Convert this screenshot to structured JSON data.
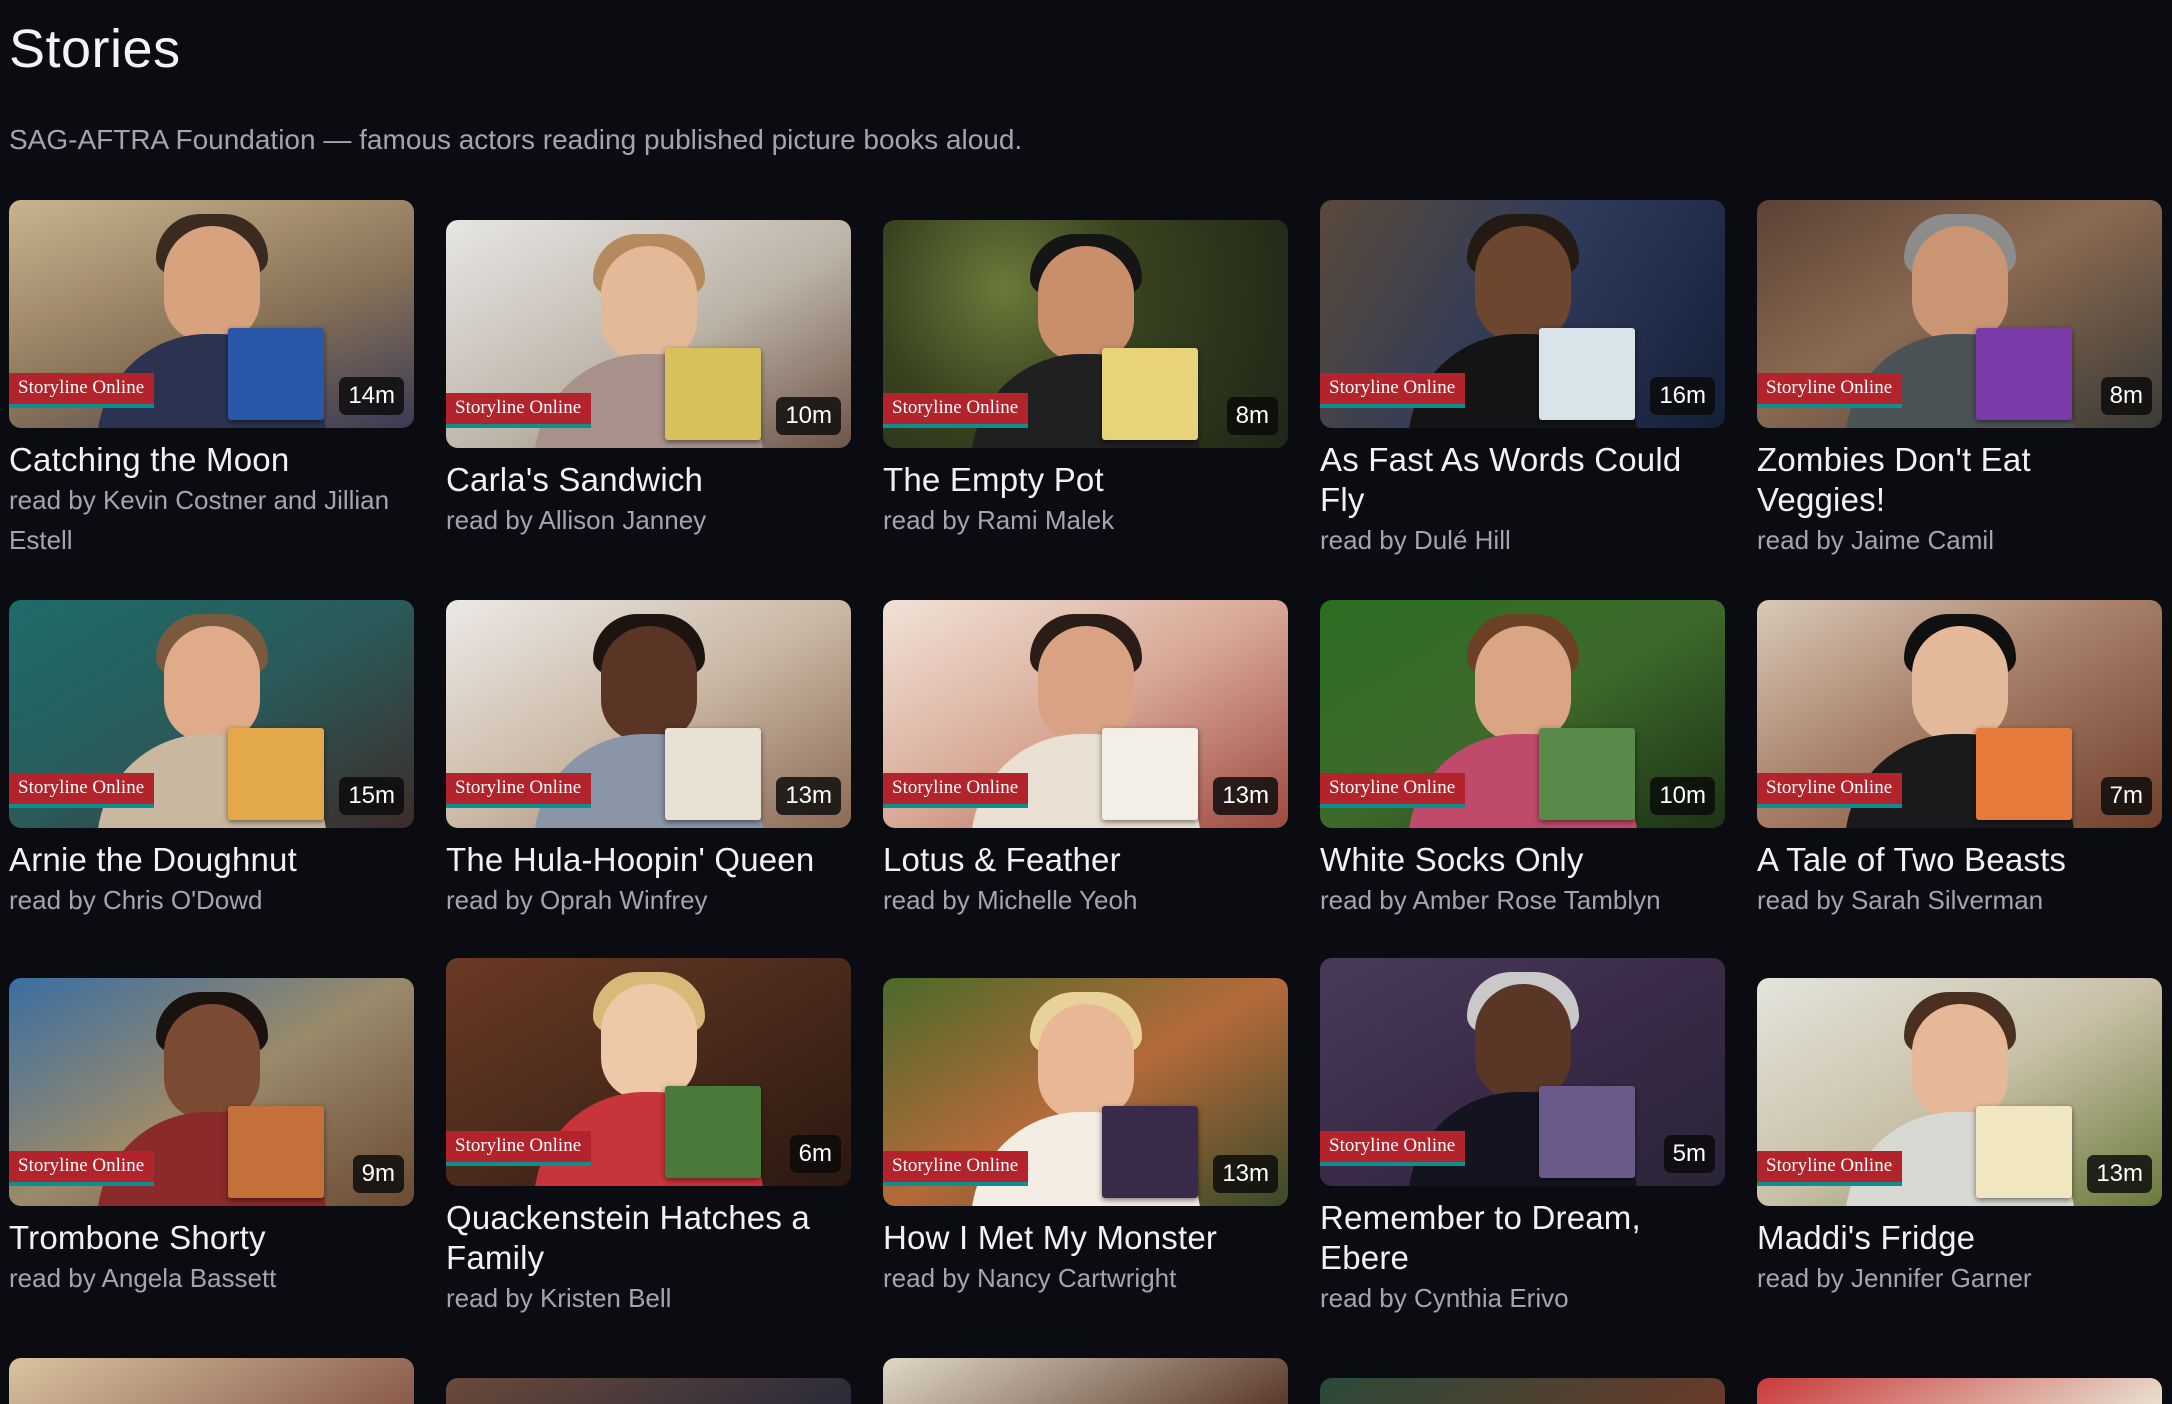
{
  "header": {
    "title": "Stories",
    "subtitle": "SAG-AFTRA Foundation — famous actors reading published picture books aloud."
  },
  "brand_label": "Storyline Online",
  "stories": [
    {
      "title": "Catching the Moon",
      "reader": "read by Kevin Costner and Jillian Estell",
      "duration": "14m"
    },
    {
      "title": "Carla's Sandwich",
      "reader": "read by Allison Janney",
      "duration": "10m"
    },
    {
      "title": "The Empty Pot",
      "reader": "read by Rami Malek",
      "duration": "8m"
    },
    {
      "title": "As Fast As Words Could Fly",
      "reader": "read by Dulé Hill",
      "duration": "16m"
    },
    {
      "title": "Zombies Don't Eat Veggies!",
      "reader": "read by Jaime Camil",
      "duration": "8m"
    },
    {
      "title": "Arnie the Doughnut",
      "reader": "read by Chris O'Dowd",
      "duration": "15m"
    },
    {
      "title": "The Hula-Hoopin' Queen",
      "reader": "read by Oprah Winfrey",
      "duration": "13m"
    },
    {
      "title": "Lotus & Feather",
      "reader": "read by Michelle Yeoh",
      "duration": "13m"
    },
    {
      "title": "White Socks Only",
      "reader": "read by Amber Rose Tamblyn",
      "duration": "10m"
    },
    {
      "title": "A Tale of Two Beasts",
      "reader": "read by Sarah Silverman",
      "duration": "7m"
    },
    {
      "title": "Trombone Shorty",
      "reader": "read by Angela Bassett",
      "duration": "9m"
    },
    {
      "title": "Quackenstein Hatches a Family",
      "reader": "read by Kristen Bell",
      "duration": "6m"
    },
    {
      "title": "How I Met My Monster",
      "reader": "read by Nancy Cartwright",
      "duration": "13m"
    },
    {
      "title": "Remember to Dream, Ebere",
      "reader": "read by Cynthia Erivo",
      "duration": "5m"
    },
    {
      "title": "Maddi's Fridge",
      "reader": "read by Jennifer Garner",
      "duration": "13m"
    }
  ],
  "colors": {
    "background": "#0b0b12",
    "brand_red": "#b3232b",
    "brand_teal": "#0e8f8f",
    "muted_text": "#a4a4ad"
  }
}
